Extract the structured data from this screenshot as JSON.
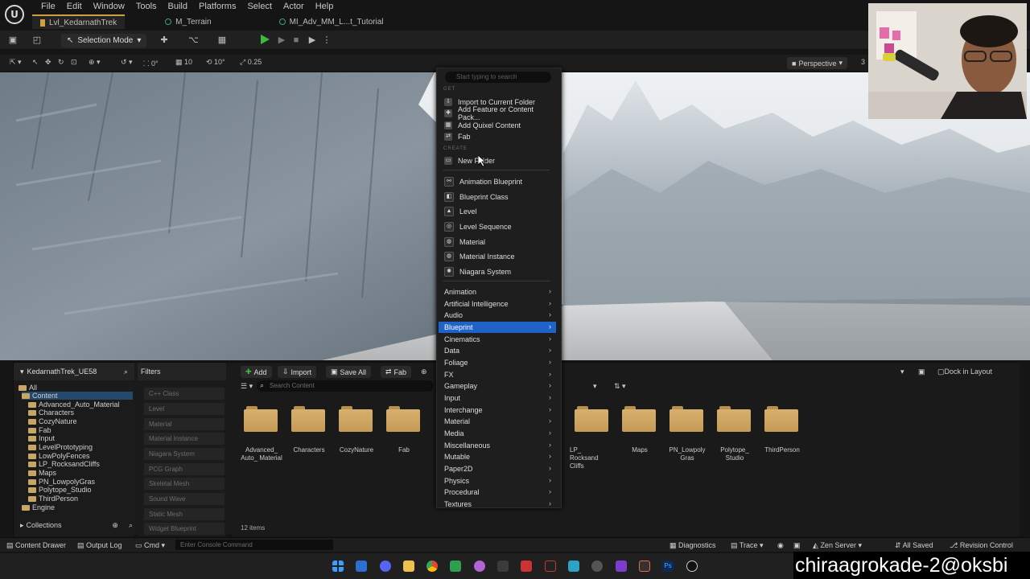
{
  "menubar": {
    "logo": "U",
    "items": [
      "File",
      "Edit",
      "Window",
      "Tools",
      "Build",
      "Platforms",
      "Select",
      "Actor",
      "Help"
    ]
  },
  "tabs": [
    {
      "label": "Lvl_KedarnathTrek",
      "icon": "level-icon"
    },
    {
      "label": "M_Terrain",
      "icon": "material-icon"
    },
    {
      "label": "MI_Adv_MM_L...t_Tutorial",
      "icon": "material-instance-icon"
    }
  ],
  "toolbar": {
    "selection_mode": "Selection Mode"
  },
  "viewport_toolbar": {
    "rot": "0°",
    "grid": "10",
    "angle": "10°",
    "scale": "0.25",
    "perspective": "Perspective",
    "extra": "3"
  },
  "context_menu": {
    "search_placeholder": "Start typing to search",
    "section_get": "GET",
    "section_create": "CREATE",
    "get_items": [
      "Import to Current Folder",
      "Add Feature or Content Pack...",
      "Add Quixel Content",
      "Fab"
    ],
    "new_folder": "New Folder",
    "create_items": [
      "Animation Blueprint",
      "Blueprint Class",
      "Level",
      "Level Sequence",
      "Material",
      "Material Instance",
      "Niagara System"
    ],
    "submenus": [
      "Animation",
      "Artificial Intelligence",
      "Audio",
      "Blueprint",
      "Cinematics",
      "Data",
      "Foliage",
      "FX",
      "Gameplay",
      "Input",
      "Interchange",
      "Material",
      "Media",
      "Miscellaneous",
      "Mutable",
      "Paper2D",
      "Physics",
      "Procedural",
      "Textures"
    ],
    "highlighted": "Blueprint"
  },
  "content_browser": {
    "project": "KedarnathTrek_UE58",
    "tree": [
      "All",
      "Content",
      "Advanced_Auto_Material",
      "Characters",
      "CozyNature",
      "Fab",
      "Input",
      "LevelPrototyping",
      "LowPolyFences",
      "LP_RocksandCliffs",
      "Maps",
      "PN_LowpolyGras",
      "Polytope_Studio",
      "ThirdPerson",
      "Engine"
    ],
    "collections": "Collections",
    "filters_title": "Filters",
    "filters": [
      "C++ Class",
      "Level",
      "Material",
      "Material Instance",
      "Niagara System",
      "PCG Graph",
      "Skeletal Mesh",
      "Sound Wave",
      "Static Mesh",
      "Widget Blueprint"
    ],
    "add": "Add",
    "import": "Import",
    "save_all": "Save All",
    "fab": "Fab",
    "search_placeholder": "Search Content",
    "dock": "Dock in Layout",
    "folders": [
      "Advanced_ Auto_ Material",
      "Characters",
      "CozyNature",
      "Fab",
      "LP_ Rocksand Cliffs",
      "Maps",
      "PN_Lowpoly Gras",
      "Polytope_ Studio",
      "ThirdPerson"
    ],
    "item_count": "12 items"
  },
  "statusbar": {
    "content_drawer": "Content Drawer",
    "output_log": "Output Log",
    "cmd": "Cmd",
    "console_placeholder": "Enter Console Command",
    "diagnostics": "Diagnostics",
    "trace": "Trace",
    "zen": "Zen Server",
    "saved": "All Saved",
    "revision": "Revision Control"
  },
  "watermark": "chiraagrokade-2@oksbi"
}
